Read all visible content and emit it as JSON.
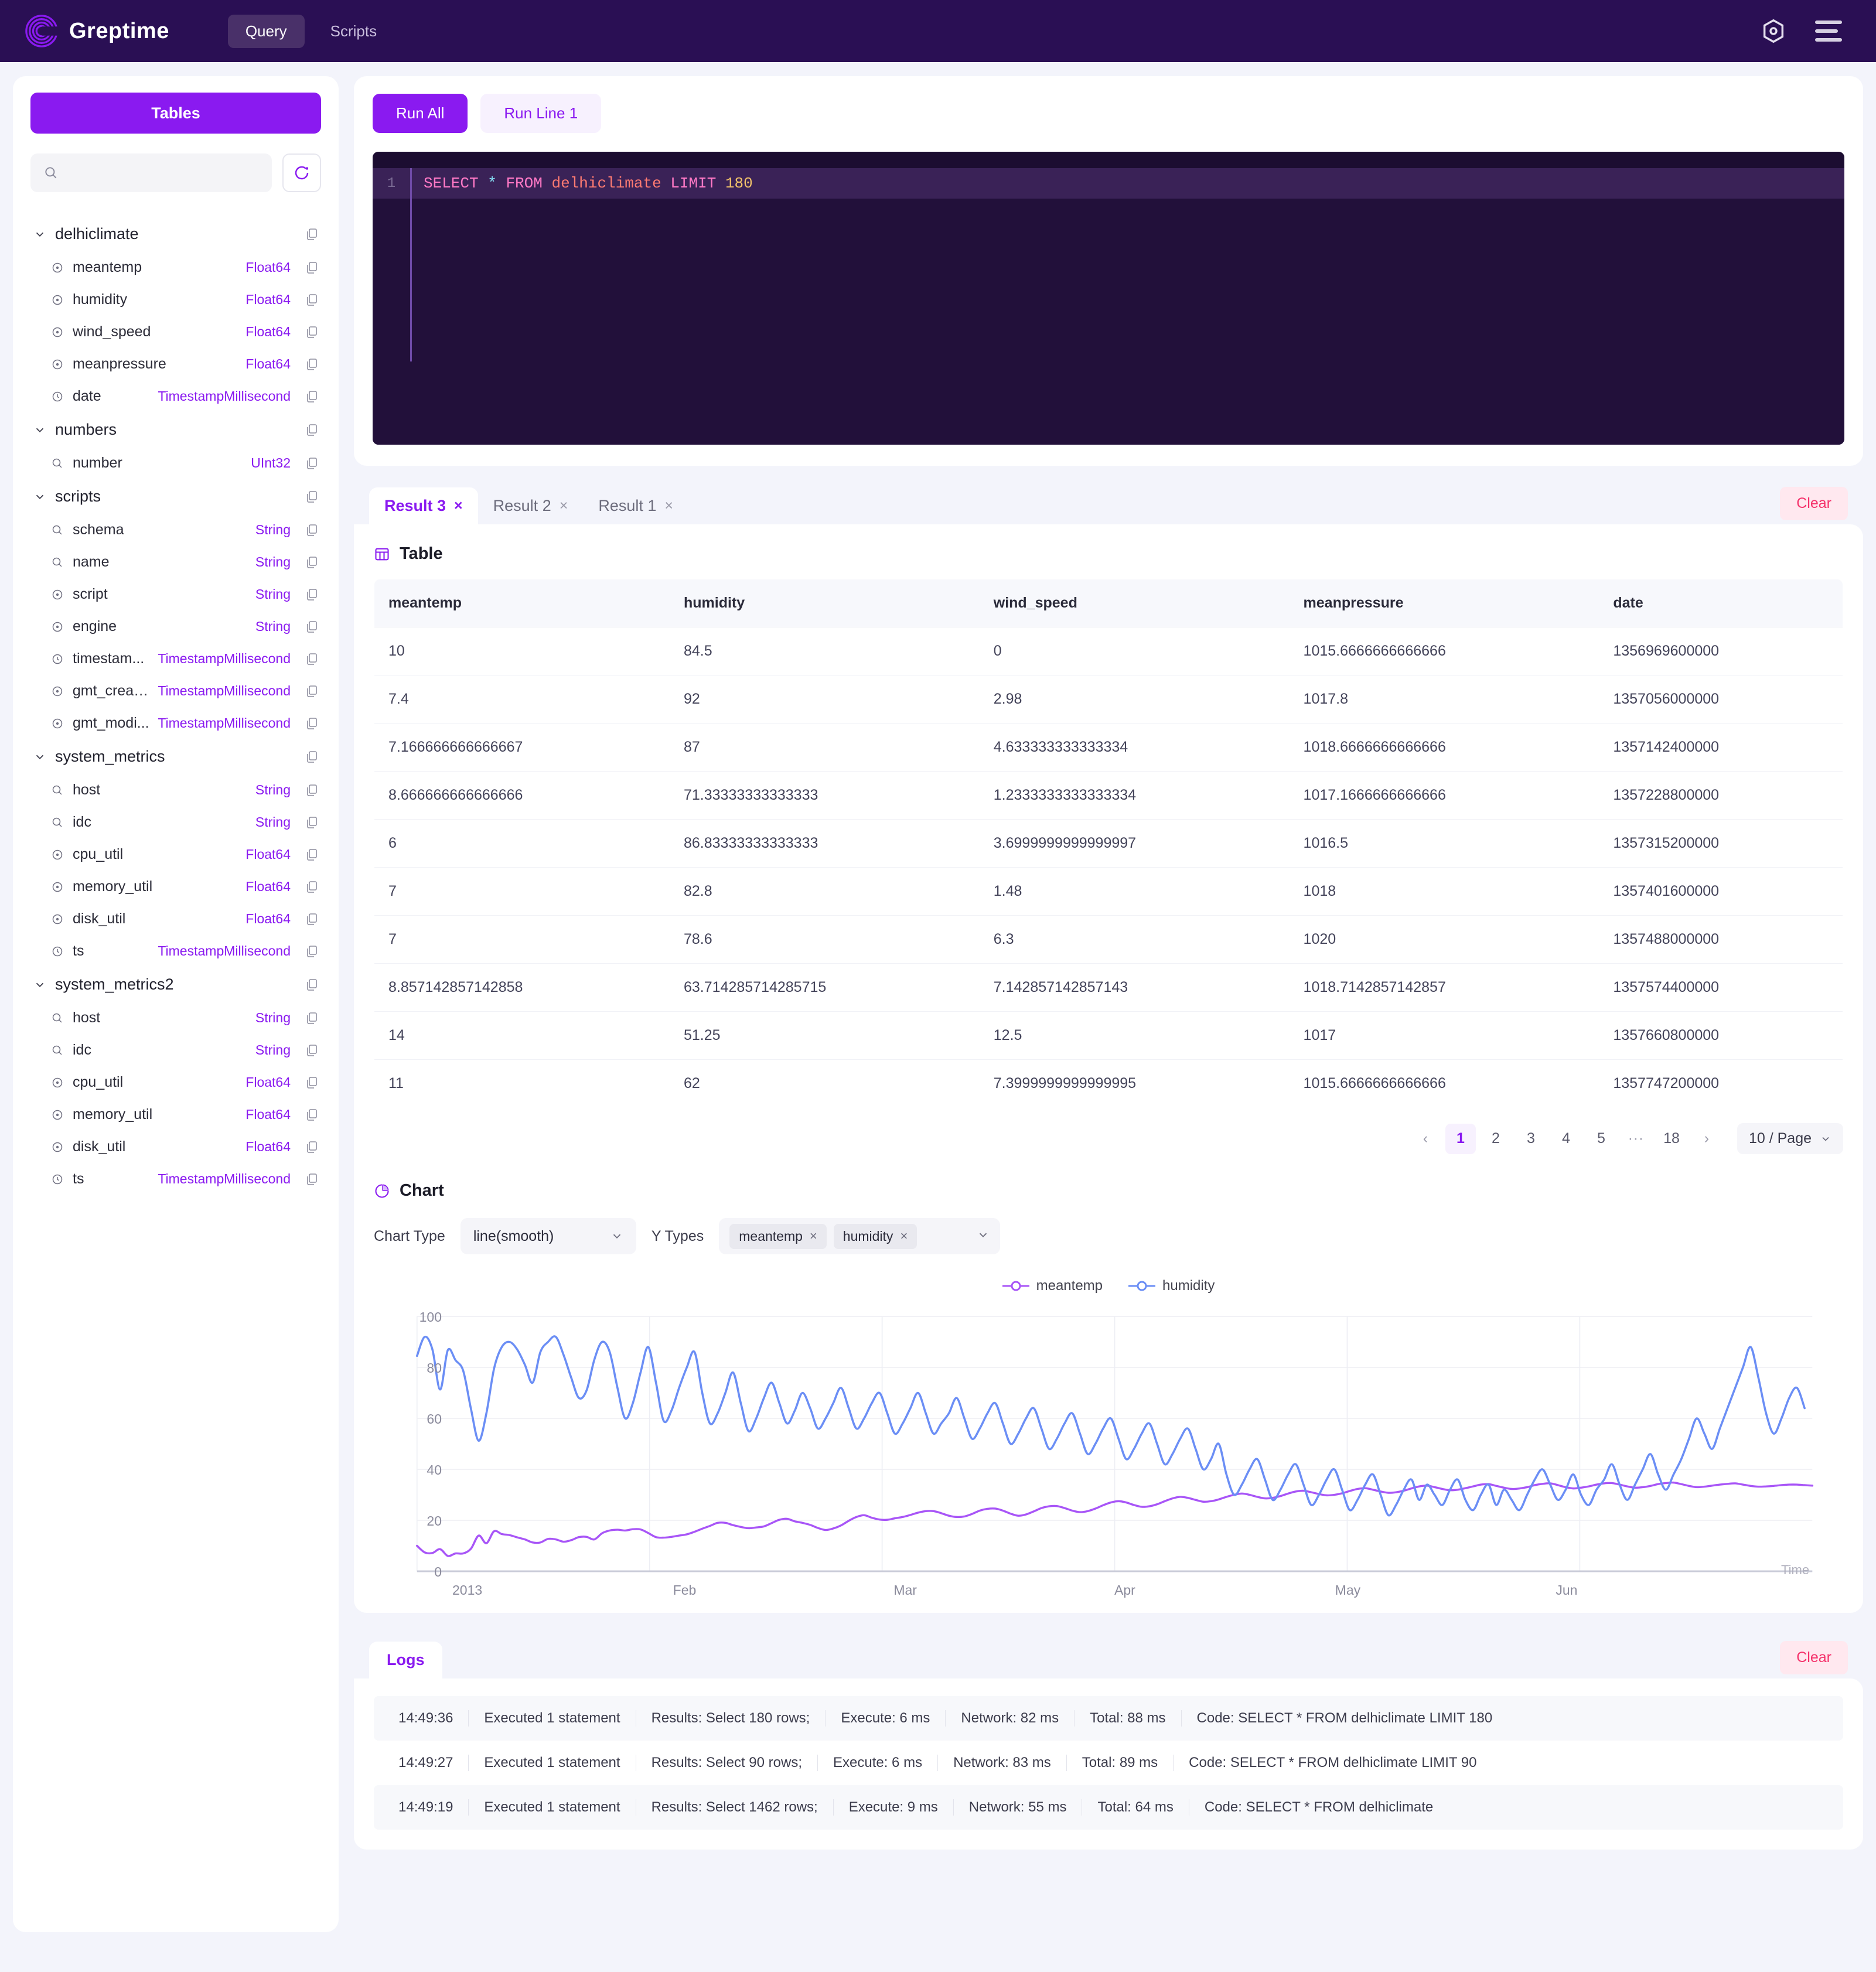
{
  "header": {
    "brand": "Greptime",
    "nav": [
      {
        "label": "Query",
        "active": true
      },
      {
        "label": "Scripts",
        "active": false
      }
    ],
    "settings_icon": "hexagon-gear-icon",
    "menu_icon": "hamburger-menu-icon"
  },
  "sidebar": {
    "tables_button": "Tables",
    "search_placeholder": "",
    "search_value": "",
    "refresh_icon": "refresh-icon",
    "tables": [
      {
        "name": "delhiclimate",
        "expanded": true,
        "columns": [
          {
            "name": "meantemp",
            "type": "Float64",
            "kind": "field"
          },
          {
            "name": "humidity",
            "type": "Float64",
            "kind": "field"
          },
          {
            "name": "wind_speed",
            "type": "Float64",
            "kind": "field"
          },
          {
            "name": "meanpressure",
            "type": "Float64",
            "kind": "field"
          },
          {
            "name": "date",
            "type": "TimestampMillisecond",
            "kind": "time"
          }
        ]
      },
      {
        "name": "numbers",
        "expanded": true,
        "columns": [
          {
            "name": "number",
            "type": "UInt32",
            "kind": "tag"
          }
        ]
      },
      {
        "name": "scripts",
        "expanded": true,
        "columns": [
          {
            "name": "schema",
            "type": "String",
            "kind": "tag"
          },
          {
            "name": "name",
            "type": "String",
            "kind": "tag"
          },
          {
            "name": "script",
            "type": "String",
            "kind": "field"
          },
          {
            "name": "engine",
            "type": "String",
            "kind": "field"
          },
          {
            "name": "timestam...",
            "type": "TimestampMillisecond",
            "kind": "time"
          },
          {
            "name": "gmt_creat...",
            "type": "TimestampMillisecond",
            "kind": "field"
          },
          {
            "name": "gmt_modi...",
            "type": "TimestampMillisecond",
            "kind": "field"
          }
        ]
      },
      {
        "name": "system_metrics",
        "expanded": true,
        "columns": [
          {
            "name": "host",
            "type": "String",
            "kind": "tag"
          },
          {
            "name": "idc",
            "type": "String",
            "kind": "tag"
          },
          {
            "name": "cpu_util",
            "type": "Float64",
            "kind": "field"
          },
          {
            "name": "memory_util",
            "type": "Float64",
            "kind": "field"
          },
          {
            "name": "disk_util",
            "type": "Float64",
            "kind": "field"
          },
          {
            "name": "ts",
            "type": "TimestampMillisecond",
            "kind": "time"
          }
        ]
      },
      {
        "name": "system_metrics2",
        "expanded": true,
        "columns": [
          {
            "name": "host",
            "type": "String",
            "kind": "tag"
          },
          {
            "name": "idc",
            "type": "String",
            "kind": "tag"
          },
          {
            "name": "cpu_util",
            "type": "Float64",
            "kind": "field"
          },
          {
            "name": "memory_util",
            "type": "Float64",
            "kind": "field"
          },
          {
            "name": "disk_util",
            "type": "Float64",
            "kind": "field"
          },
          {
            "name": "ts",
            "type": "TimestampMillisecond",
            "kind": "time"
          }
        ]
      }
    ]
  },
  "editor": {
    "run_all_label": "Run All",
    "run_line_label": "Run Line 1",
    "line_number": "1",
    "sql": {
      "select": "SELECT",
      "star": "*",
      "from": "FROM",
      "table": "delhiclimate",
      "limit": "LIMIT",
      "count": "180"
    }
  },
  "results": {
    "tabs": [
      {
        "label": "Result 1",
        "active": false
      },
      {
        "label": "Result 2",
        "active": false
      },
      {
        "label": "Result 3",
        "active": true
      }
    ],
    "close_glyph": "×",
    "clear_label": "Clear",
    "table_section_title": "Table",
    "table_icon": "table-icon",
    "columns": [
      "meantemp",
      "humidity",
      "wind_speed",
      "meanpressure",
      "date"
    ],
    "rows": [
      [
        "10",
        "84.5",
        "0",
        "1015.6666666666666",
        "1356969600000"
      ],
      [
        "7.4",
        "92",
        "2.98",
        "1017.8",
        "1357056000000"
      ],
      [
        "7.166666666666667",
        "87",
        "4.633333333333334",
        "1018.6666666666666",
        "1357142400000"
      ],
      [
        "8.666666666666666",
        "71.33333333333333",
        "1.2333333333333334",
        "1017.1666666666666",
        "1357228800000"
      ],
      [
        "6",
        "86.83333333333333",
        "3.6999999999999997",
        "1016.5",
        "1357315200000"
      ],
      [
        "7",
        "82.8",
        "1.48",
        "1018",
        "1357401600000"
      ],
      [
        "7",
        "78.6",
        "6.3",
        "1020",
        "1357488000000"
      ],
      [
        "8.857142857142858",
        "63.714285714285715",
        "7.142857142857143",
        "1018.7142857142857",
        "1357574400000"
      ],
      [
        "14",
        "51.25",
        "12.5",
        "1017",
        "1357660800000"
      ],
      [
        "11",
        "62",
        "7.3999999999999995",
        "1015.6666666666666",
        "1357747200000"
      ]
    ],
    "pagination": {
      "prev": "‹",
      "next": "›",
      "pages": [
        "1",
        "2",
        "3",
        "4",
        "5"
      ],
      "dots": "∙∙∙",
      "last": "18",
      "current": "1",
      "page_size": "10 / Page"
    }
  },
  "chart": {
    "section_title": "Chart",
    "chart_icon": "pie-chart-icon",
    "chart_type_label": "Chart Type",
    "chart_type_value": "line(smooth)",
    "y_types_label": "Y Types",
    "y_types": [
      "meantemp",
      "humidity"
    ],
    "chip_close": "×"
  },
  "chart_data": {
    "type": "line",
    "title": "",
    "xlabel": "Time",
    "ylabel": "",
    "ylim": [
      0,
      100
    ],
    "yticks": [
      0,
      20,
      40,
      60,
      80,
      100
    ],
    "xticks": [
      "2013",
      "Feb",
      "Mar",
      "Apr",
      "May",
      "Jun"
    ],
    "grid": true,
    "legend": "top-center",
    "smooth": true,
    "colors": {
      "meantemp": "#a855f7",
      "humidity": "#6b8ef5"
    },
    "series": [
      {
        "name": "meantemp",
        "color": "#a855f7",
        "values": [
          10,
          7.4,
          7.17,
          8.67,
          6,
          7,
          7,
          8.86,
          14,
          11,
          15.7,
          14.6,
          14.2,
          13.3,
          12.5,
          11.3,
          11.3,
          12.7,
          12.5,
          11.6,
          12.2,
          13.4,
          13.5,
          12.5,
          14.9,
          16,
          16.3,
          16,
          16.5,
          16.4,
          15,
          13.4,
          13.2,
          13.5,
          14,
          14.5,
          15.5,
          16.7,
          17.8,
          19,
          19,
          18.1,
          17.4,
          16.9,
          17.2,
          17.6,
          18.9,
          20.2,
          20.6,
          19.6,
          19,
          18.2,
          17,
          16.2,
          16.8,
          18,
          19.8,
          21.3,
          22,
          21,
          20.3,
          20.2,
          20.8,
          21.3,
          22.1,
          23,
          23.6,
          23.6,
          22.8,
          21.8,
          21.3,
          21.5,
          22.5,
          23.8,
          24.5,
          24.6,
          23.8,
          22.6,
          21.8,
          22.3,
          23.5,
          24.8,
          25.5,
          25.6,
          24.8,
          23.8,
          23.2,
          23.6,
          24.6,
          25.9,
          27,
          27.5,
          27,
          26,
          25.3,
          25.5,
          26.3,
          27.5,
          28.6,
          29.2,
          28.8,
          28,
          27.3,
          27.5,
          28.2,
          29.2,
          30,
          30.5,
          30,
          29.2,
          28.6,
          28.8,
          29.5,
          30.5,
          31.3,
          31.6,
          31,
          30.3,
          29.8,
          30,
          30.6,
          31.5,
          32.3,
          32.6,
          32,
          31.3,
          30.8,
          31,
          31.6,
          32.5,
          33.3,
          33.6,
          33,
          32.3,
          31.8,
          32,
          32.6,
          33.3,
          34,
          34.2,
          33.5,
          32.8,
          32.3,
          32.5,
          33,
          33.8,
          34.3,
          34.5,
          33.8,
          33,
          32.5,
          32.8,
          33.3,
          34,
          34.5,
          34.6,
          34,
          33.3,
          32.8,
          33,
          33.5,
          34.2,
          34.6,
          34.8,
          34.2,
          33.5,
          33,
          33.2,
          33.6,
          34,
          34.3,
          34.5,
          34,
          33.5,
          33.2,
          33.3,
          33.5,
          33.8,
          34,
          34,
          33.8,
          33.6
        ]
      },
      {
        "name": "humidity",
        "color": "#6b8ef5",
        "values": [
          84.5,
          92,
          87,
          71.3,
          86.8,
          82.8,
          78.6,
          63.7,
          51.2,
          62,
          79.6,
          88,
          90,
          87,
          81,
          74,
          86,
          90,
          92,
          85,
          76,
          68,
          71,
          83,
          90,
          86,
          72,
          60,
          66,
          78,
          88,
          74,
          59,
          63,
          72,
          80,
          86,
          70,
          58,
          62,
          70,
          78,
          66,
          55,
          60,
          68,
          74,
          66,
          58,
          63,
          70,
          64,
          56,
          60,
          66,
          72,
          64,
          56,
          60,
          66,
          70,
          62,
          54,
          58,
          64,
          70,
          62,
          54,
          58,
          62,
          68,
          60,
          52,
          56,
          62,
          66,
          58,
          50,
          54,
          60,
          64,
          56,
          48,
          52,
          58,
          62,
          54,
          46,
          50,
          56,
          60,
          52,
          44,
          48,
          54,
          58,
          50,
          42,
          46,
          52,
          56,
          48,
          40,
          44,
          50,
          38,
          30,
          34,
          40,
          44,
          36,
          28,
          32,
          38,
          42,
          34,
          26,
          30,
          36,
          40,
          32,
          24,
          28,
          34,
          38,
          30,
          22,
          26,
          32,
          36,
          28,
          34,
          30,
          26,
          32,
          36,
          28,
          24,
          30,
          34,
          26,
          32,
          28,
          24,
          30,
          36,
          40,
          34,
          28,
          32,
          38,
          30,
          26,
          32,
          36,
          42,
          34,
          28,
          34,
          40,
          46,
          38,
          32,
          38,
          44,
          52,
          60,
          54,
          48,
          56,
          64,
          72,
          80,
          88,
          76,
          62,
          54,
          60,
          68,
          72,
          64
        ]
      }
    ]
  },
  "logs": {
    "tab_label": "Logs",
    "clear_label": "Clear",
    "entries": [
      {
        "time": "14:49:36",
        "statement": "Executed 1 statement",
        "results": "Results: Select 180 rows;",
        "execute": "Execute: 6 ms",
        "network": "Network: 82 ms",
        "total": "Total: 88 ms",
        "code": "Code: SELECT * FROM delhiclimate LIMIT 180"
      },
      {
        "time": "14:49:27",
        "statement": "Executed 1 statement",
        "results": "Results: Select 90 rows;",
        "execute": "Execute: 6 ms",
        "network": "Network: 83 ms",
        "total": "Total: 89 ms",
        "code": "Code: SELECT * FROM delhiclimate LIMIT 90"
      },
      {
        "time": "14:49:19",
        "statement": "Executed 1 statement",
        "results": "Results: Select 1462 rows;",
        "execute": "Execute: 9 ms",
        "network": "Network: 55 ms",
        "total": "Total: 64 ms",
        "code": "Code: SELECT * FROM delhiclimate"
      }
    ]
  }
}
